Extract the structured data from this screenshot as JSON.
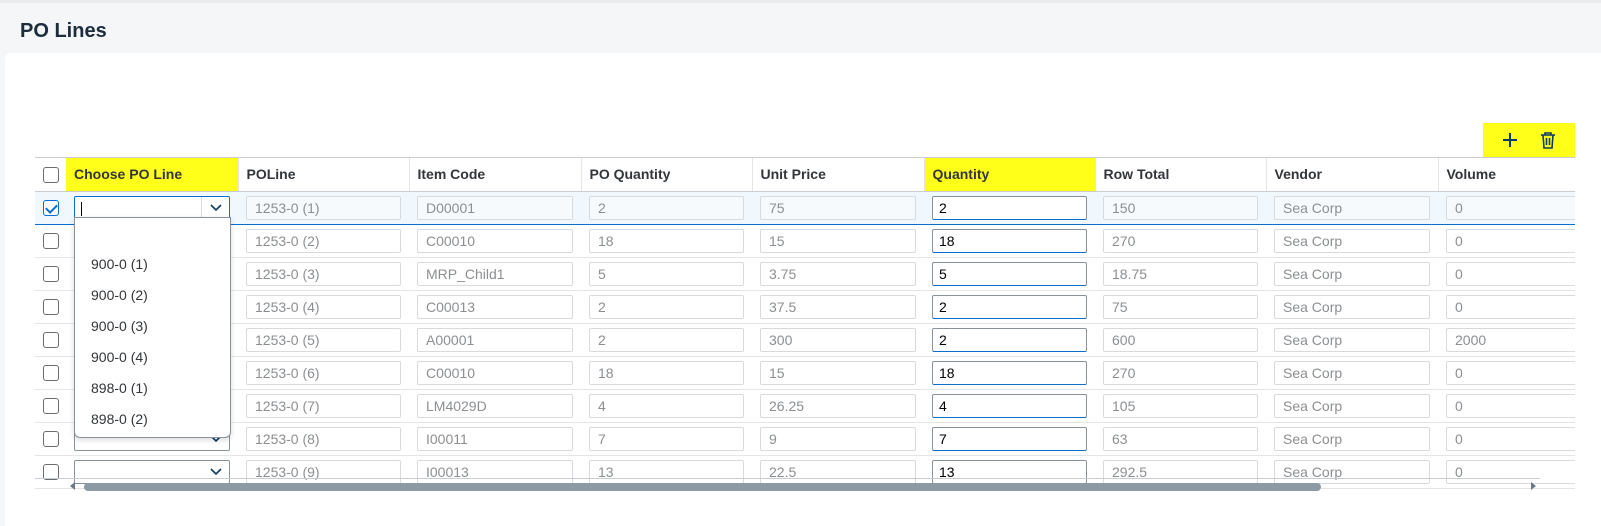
{
  "page": {
    "title": "PO Lines"
  },
  "colors": {
    "highlight": "#ffff1a",
    "accent": "#0a6ed1",
    "readonly_text": "#8c8f92"
  },
  "toolbar": {
    "add_icon": "plus-icon",
    "delete_icon": "trash-icon"
  },
  "table": {
    "columns": [
      "Choose PO Line",
      "POLine",
      "Item Code",
      "PO Quantity",
      "Unit Price",
      "Quantity",
      "Row Total",
      "Vendor",
      "Volume"
    ],
    "rows": [
      {
        "selected": true,
        "choose": "",
        "poline": "1253-0 (1)",
        "item": "D00001",
        "po_qty": "2",
        "price": "75",
        "qty": "2",
        "total": "150",
        "vendor": "Sea Corp",
        "volume": "0"
      },
      {
        "selected": false,
        "choose": "",
        "poline": "1253-0 (2)",
        "item": "C00010",
        "po_qty": "18",
        "price": "15",
        "qty": "18",
        "total": "270",
        "vendor": "Sea Corp",
        "volume": "0"
      },
      {
        "selected": false,
        "choose": "",
        "poline": "1253-0 (3)",
        "item": "MRP_Child1",
        "po_qty": "5",
        "price": "3.75",
        "qty": "5",
        "total": "18.75",
        "vendor": "Sea Corp",
        "volume": "0"
      },
      {
        "selected": false,
        "choose": "",
        "poline": "1253-0 (4)",
        "item": "C00013",
        "po_qty": "2",
        "price": "37.5",
        "qty": "2",
        "total": "75",
        "vendor": "Sea Corp",
        "volume": "0"
      },
      {
        "selected": false,
        "choose": "",
        "poline": "1253-0 (5)",
        "item": "A00001",
        "po_qty": "2",
        "price": "300",
        "qty": "2",
        "total": "600",
        "vendor": "Sea Corp",
        "volume": "2000"
      },
      {
        "selected": false,
        "choose": "",
        "poline": "1253-0 (6)",
        "item": "C00010",
        "po_qty": "18",
        "price": "15",
        "qty": "18",
        "total": "270",
        "vendor": "Sea Corp",
        "volume": "0"
      },
      {
        "selected": false,
        "choose": "",
        "poline": "1253-0 (7)",
        "item": "LM4029D",
        "po_qty": "4",
        "price": "26.25",
        "qty": "4",
        "total": "105",
        "vendor": "Sea Corp",
        "volume": "0"
      },
      {
        "selected": false,
        "choose": "",
        "poline": "1253-0 (8)",
        "item": "I00011",
        "po_qty": "7",
        "price": "9",
        "qty": "7",
        "total": "63",
        "vendor": "Sea Corp",
        "volume": "0"
      },
      {
        "selected": false,
        "choose": "",
        "poline": "1253-0 (9)",
        "item": "I00013",
        "po_qty": "13",
        "price": "22.5",
        "qty": "13",
        "total": "292.5",
        "vendor": "Sea Corp",
        "volume": "0"
      }
    ]
  },
  "dropdown": {
    "options": [
      "900-0 (1)",
      "900-0 (2)",
      "900-0 (3)",
      "900-0 (4)",
      "898-0 (1)",
      "898-0 (2)"
    ]
  }
}
